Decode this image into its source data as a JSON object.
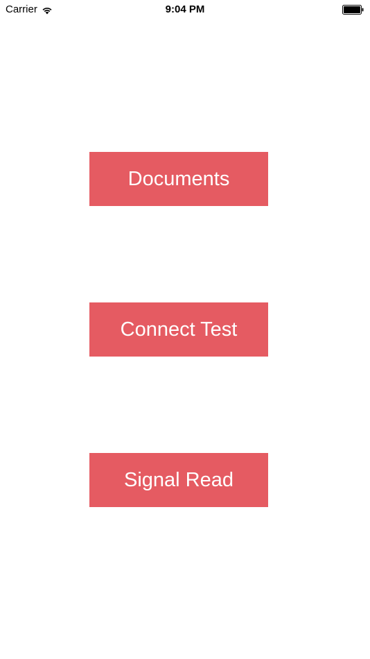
{
  "status_bar": {
    "carrier": "Carrier",
    "time": "9:04 PM",
    "wifi_icon": "wifi-icon",
    "battery_icon": "battery-icon"
  },
  "menu": {
    "button_color": "#E55B62",
    "buttons": [
      {
        "label": "Documents"
      },
      {
        "label": "Connect Test"
      },
      {
        "label": "Signal Read"
      }
    ]
  }
}
